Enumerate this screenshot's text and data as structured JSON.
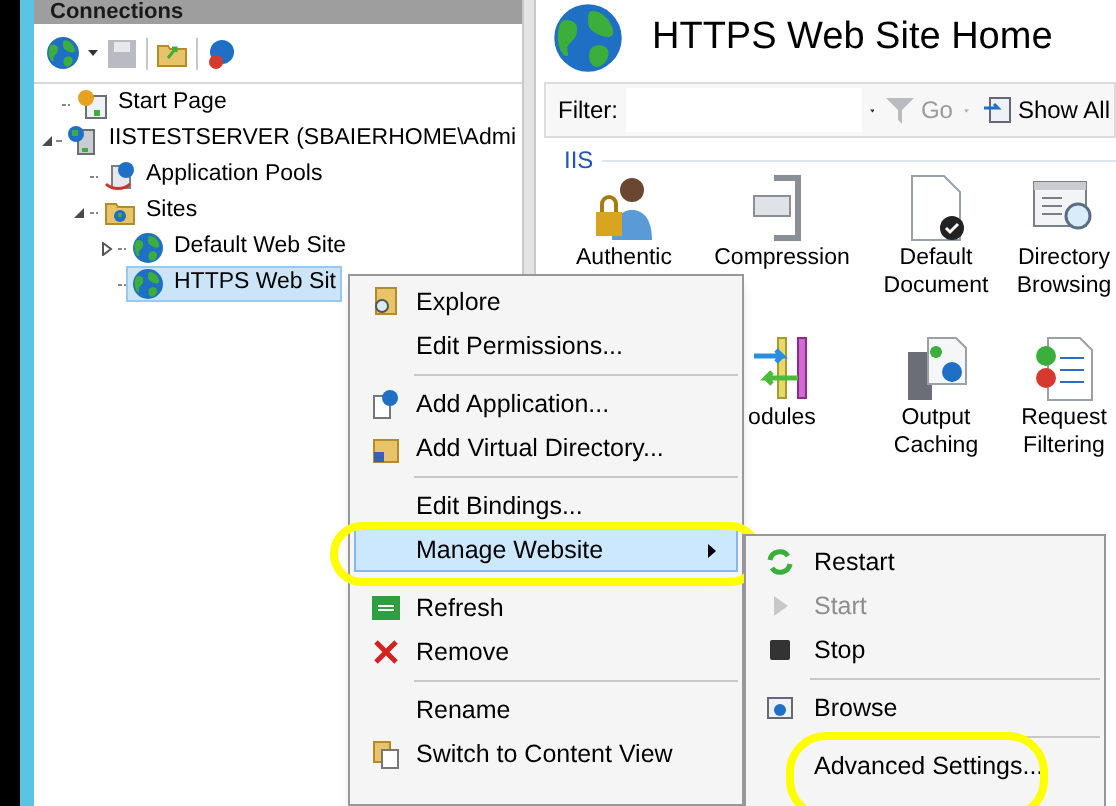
{
  "connections": {
    "title": "Connections",
    "tree": [
      {
        "kind": "start_page",
        "label": "Start Page",
        "selected": false
      },
      {
        "kind": "server",
        "label": "IISTESTSERVER (SBAIERHOME\\Admi",
        "selected": false,
        "expanded": true,
        "children": [
          {
            "kind": "app_pools",
            "label": "Application Pools",
            "selected": false
          },
          {
            "kind": "sites",
            "label": "Sites",
            "selected": false,
            "expanded": true,
            "children": [
              {
                "kind": "site",
                "label": "Default Web Site",
                "selected": false,
                "expanded": false
              },
              {
                "kind": "site",
                "label": "HTTPS Web Sit",
                "selected": true
              }
            ]
          }
        ]
      }
    ]
  },
  "home": {
    "title": "HTTPS Web Site Home",
    "filter": {
      "label": "Filter:",
      "go": "Go",
      "show_all": "Show All"
    },
    "group": "IIS",
    "feature_rows": [
      [
        {
          "kind": "auth",
          "lines": [
            "Authentic"
          ]
        },
        {
          "kind": "compression",
          "lines": [
            "Compression"
          ]
        },
        {
          "kind": "document",
          "lines": [
            "Default",
            "Document"
          ]
        },
        {
          "kind": "directory",
          "lines": [
            "Directory",
            "Browsing"
          ]
        }
      ],
      [
        {
          "kind": "modules",
          "lines": [
            "odules"
          ]
        },
        {
          "kind": "caching",
          "lines": [
            "Output",
            "Caching"
          ]
        },
        {
          "kind": "filtering",
          "lines": [
            "Request",
            "Filtering"
          ]
        }
      ]
    ]
  },
  "context_menu": [
    {
      "kind": "item",
      "label": "Explore",
      "selected": false,
      "highlighted": false
    },
    {
      "kind": "item",
      "label": "Edit Permissions...",
      "selected": false,
      "highlighted": false
    },
    {
      "kind": "separator"
    },
    {
      "kind": "item",
      "label": "Add Application...",
      "selected": false,
      "highlighted": false
    },
    {
      "kind": "item",
      "label": "Add Virtual Directory...",
      "selected": false,
      "highlighted": false
    },
    {
      "kind": "separator"
    },
    {
      "kind": "item",
      "label": "Edit Bindings...",
      "selected": false,
      "highlighted": false
    },
    {
      "kind": "submenu",
      "label": "Manage Website",
      "selected": true,
      "highlighted": true
    },
    {
      "kind": "separator"
    },
    {
      "kind": "item",
      "label": "Refresh",
      "selected": false,
      "highlighted": false
    },
    {
      "kind": "item",
      "label": "Remove",
      "selected": false,
      "highlighted": false
    },
    {
      "kind": "separator"
    },
    {
      "kind": "item",
      "label": "Rename",
      "selected": false,
      "highlighted": false
    },
    {
      "kind": "item",
      "label": "Switch to Content View",
      "selected": false,
      "highlighted": false
    }
  ],
  "submenu": [
    {
      "kind": "item",
      "label": "Restart",
      "disabled": false,
      "highlighted": false
    },
    {
      "kind": "item",
      "label": "Start",
      "disabled": true,
      "highlighted": false
    },
    {
      "kind": "item",
      "label": "Stop",
      "disabled": false,
      "highlighted": false
    },
    {
      "kind": "separator"
    },
    {
      "kind": "item",
      "label": "Browse",
      "disabled": false,
      "highlighted": false
    },
    {
      "kind": "separator"
    },
    {
      "kind": "item",
      "label": "Advanced Settings...",
      "disabled": false,
      "highlighted": true
    }
  ]
}
